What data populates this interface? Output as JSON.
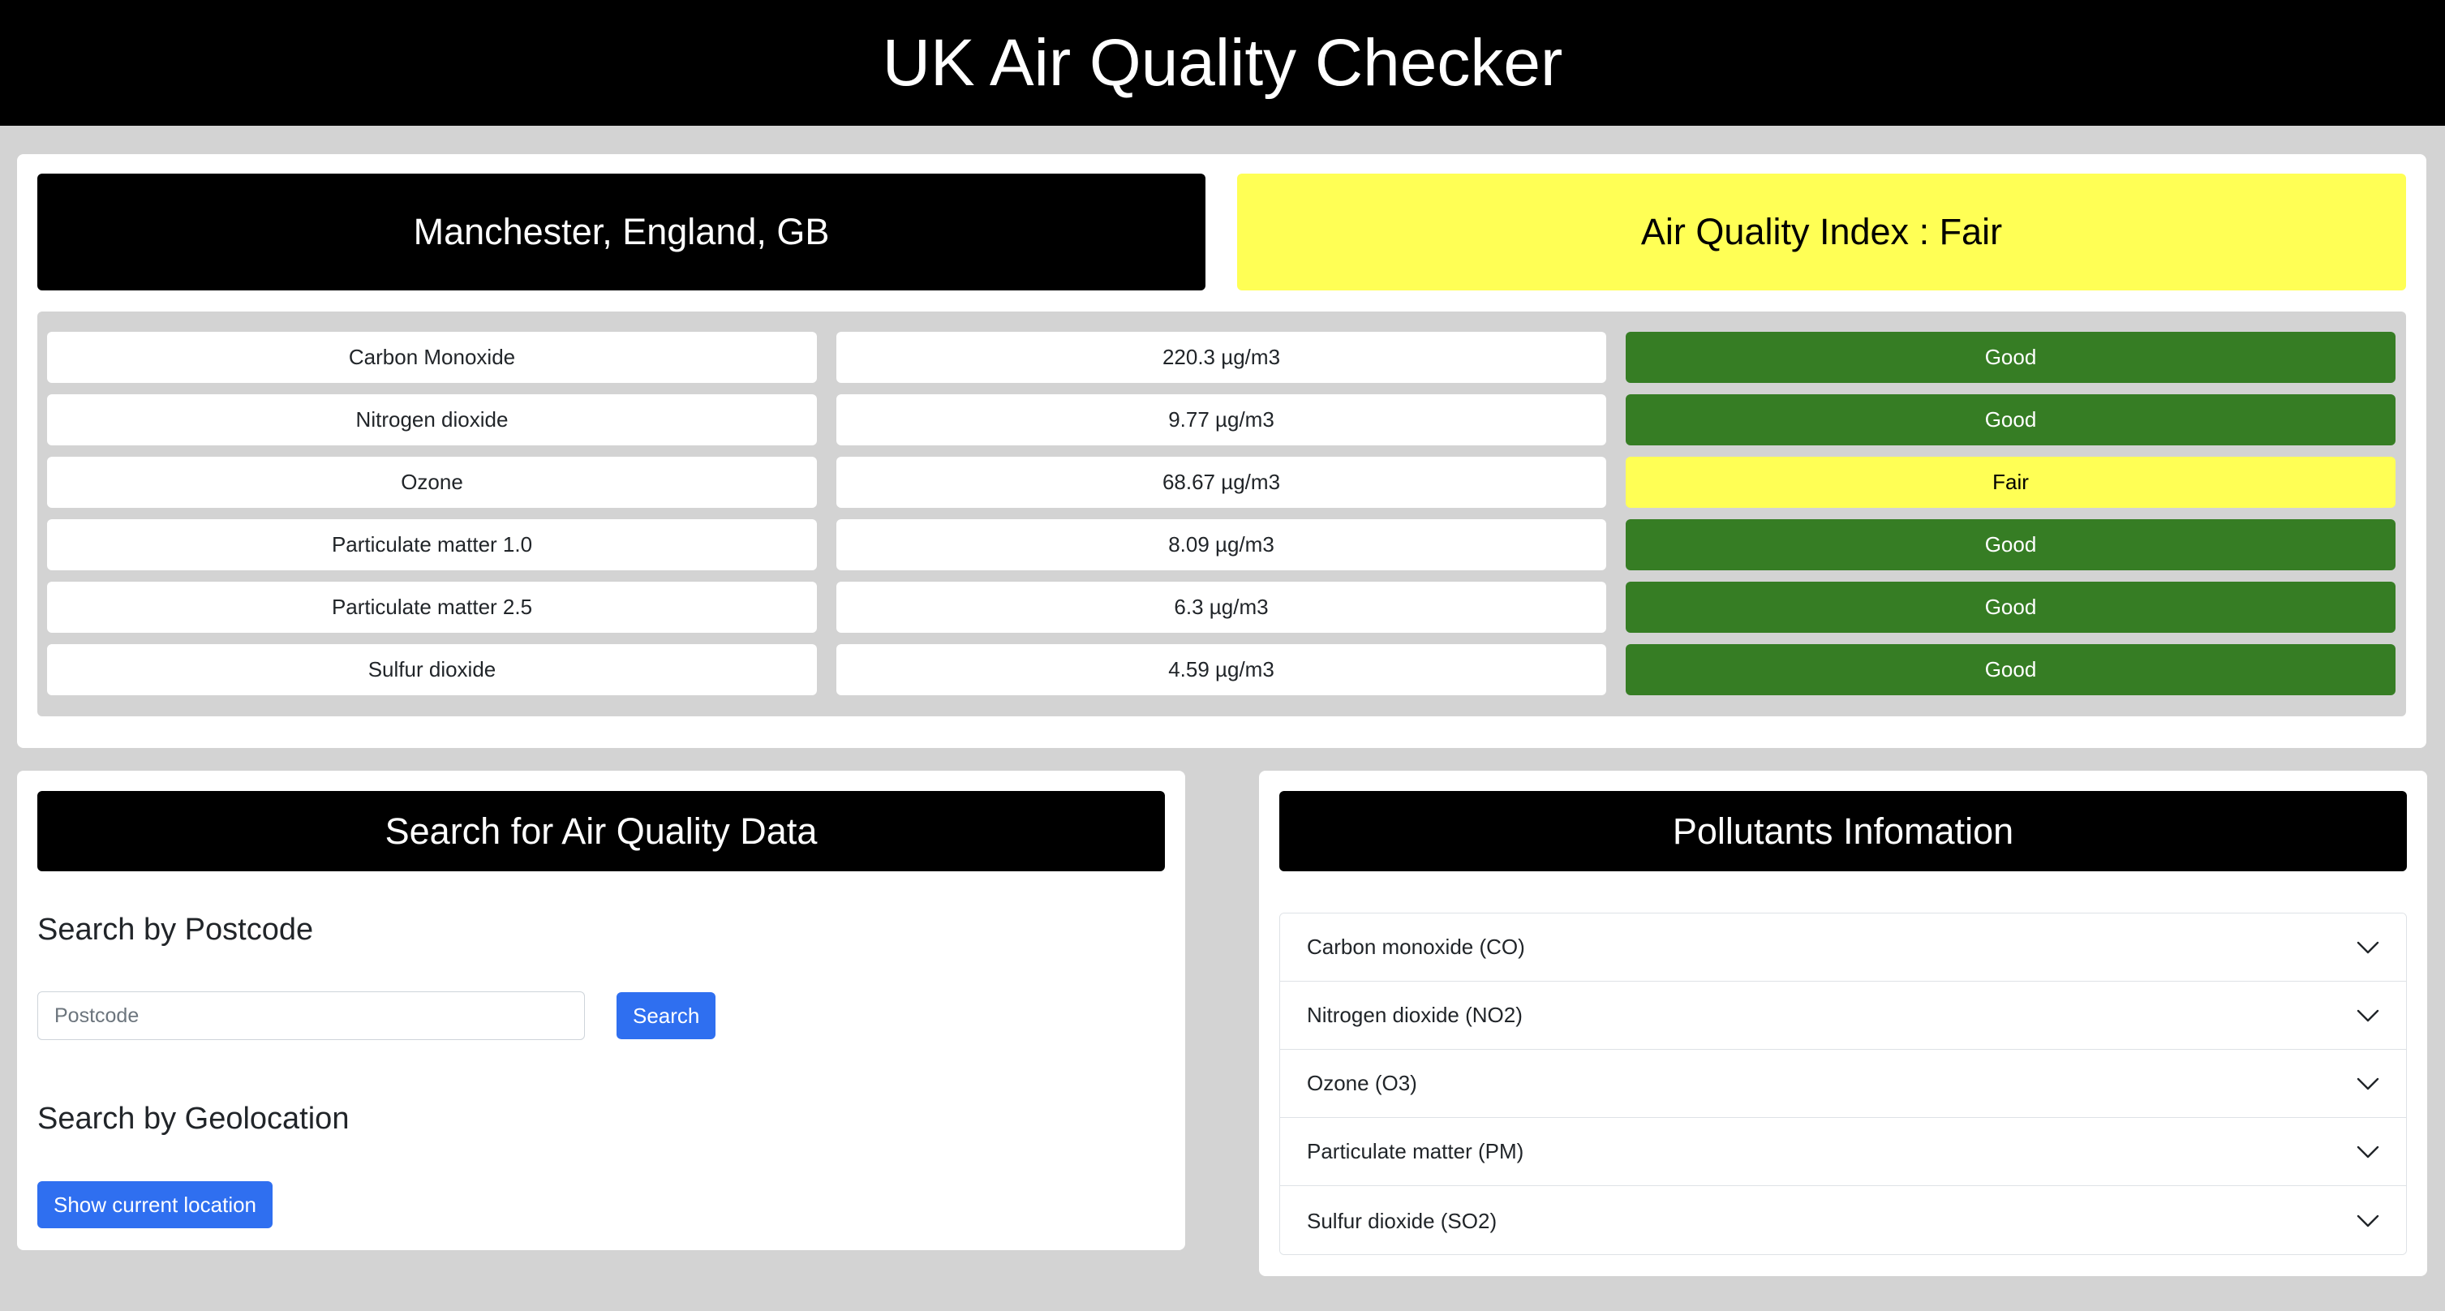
{
  "header": {
    "title": "UK Air Quality Checker"
  },
  "summary": {
    "location": "Manchester, England, GB",
    "aqi_label": "Air Quality Index : Fair",
    "aqi_color": "#ffff55"
  },
  "pollutants": [
    {
      "name": "Carbon Monoxide",
      "value": "220.3 µg/m3",
      "status": "Good"
    },
    {
      "name": "Nitrogen dioxide",
      "value": "9.77 µg/m3",
      "status": "Good"
    },
    {
      "name": "Ozone",
      "value": "68.67 µg/m3",
      "status": "Fair"
    },
    {
      "name": "Particulate matter 1.0",
      "value": "8.09 µg/m3",
      "status": "Good"
    },
    {
      "name": "Particulate matter 2.5",
      "value": "6.3 µg/m3",
      "status": "Good"
    },
    {
      "name": "Sulfur dioxide",
      "value": "4.59 µg/m3",
      "status": "Good"
    }
  ],
  "colors": {
    "good": "#367d24",
    "fair": "#ffff55",
    "primary_button": "#2f6ff0"
  },
  "search": {
    "title": "Search for Air Quality Data",
    "postcode_heading": "Search by Postcode",
    "postcode_placeholder": "Postcode",
    "search_button": "Search",
    "geo_heading": "Search by Geolocation",
    "geo_button": "Show current location"
  },
  "info": {
    "title": "Pollutants Infomation",
    "items": [
      {
        "label": "Carbon monoxide (CO)",
        "icon": "chevron-down-icon"
      },
      {
        "label": "Nitrogen dioxide (NO2)",
        "icon": "chevron-down-icon"
      },
      {
        "label": "Ozone (O3)",
        "icon": "chevron-down-icon"
      },
      {
        "label": "Particulate matter (PM)",
        "icon": "chevron-down-icon"
      },
      {
        "label": "Sulfur dioxide (SO2)",
        "icon": "chevron-down-icon"
      }
    ]
  }
}
